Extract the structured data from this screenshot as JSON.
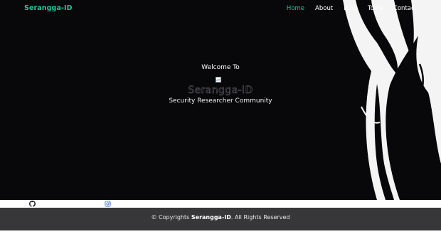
{
  "brand": {
    "name": "Serangga-ID",
    "color": "#1fc79a"
  },
  "nav": {
    "items": [
      {
        "label": "Home",
        "active": true
      },
      {
        "label": "About",
        "active": false
      },
      {
        "label": "Blog",
        "active": false
      },
      {
        "label": "Tools",
        "active": false
      },
      {
        "label": "Contact",
        "active": false
      }
    ]
  },
  "hero": {
    "welcome": "Welcome To",
    "logo_text": "Serangga-ID",
    "tagline": "Security Researcher Community",
    "background_color": "#08080a",
    "broken_image_icon": "broken-image-icon"
  },
  "social": {
    "icons": [
      "github-icon",
      "instagram-icon"
    ]
  },
  "footer": {
    "prefix": "© Copyrights ",
    "brand": "Serangga-ID",
    "suffix": ". All Rights Reserved"
  }
}
